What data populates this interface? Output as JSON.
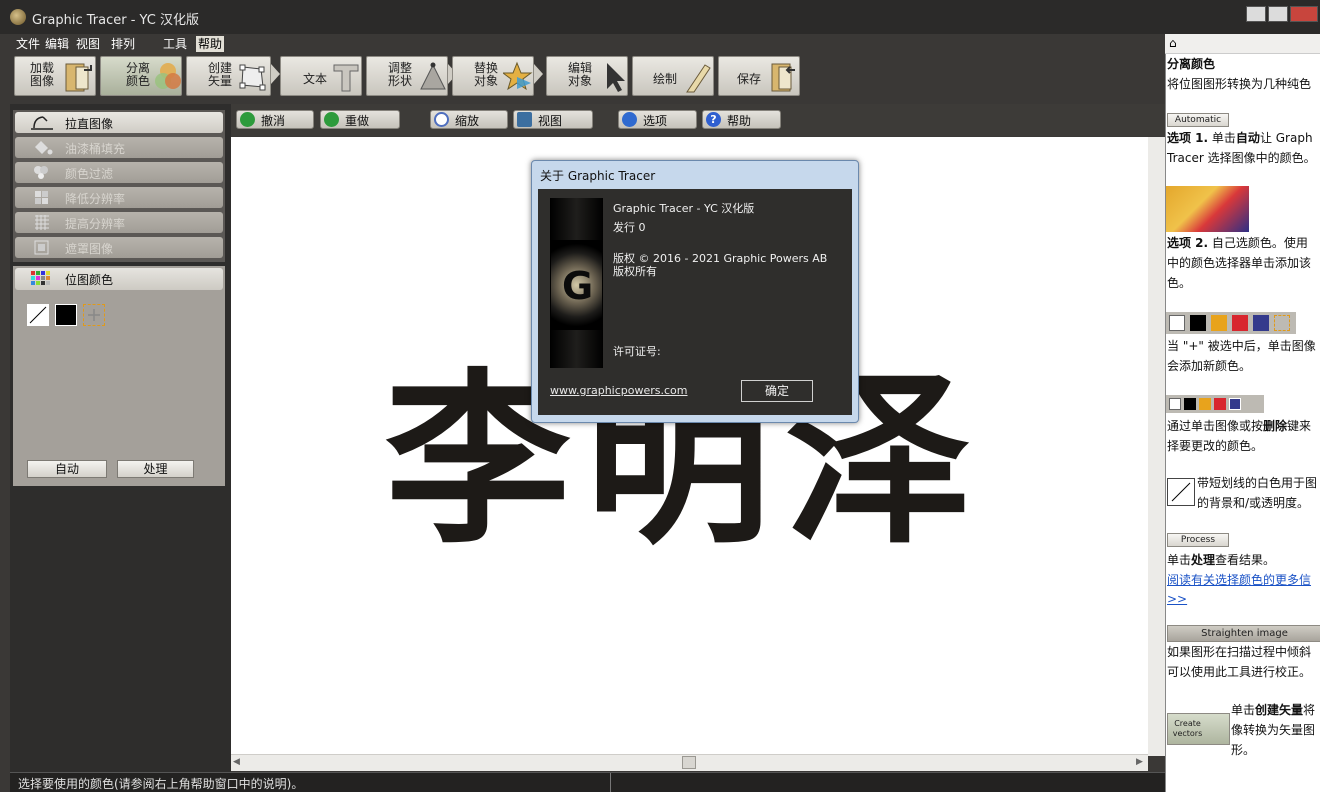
{
  "window": {
    "title": "Graphic Tracer - YC 汉化版"
  },
  "menu": [
    "文件",
    "编辑",
    "视图",
    "排列",
    "工具",
    "帮助"
  ],
  "toolbar": [
    {
      "line1": "加载",
      "line2": "图像",
      "icon": "folder-door-icon"
    },
    {
      "line1": "分离",
      "line2": "颜色",
      "icon": "color-split-icon"
    },
    {
      "line1": "创建",
      "line2": "矢量",
      "icon": "vector-shape-icon"
    },
    {
      "line1": "文本",
      "line2": "",
      "icon": "text-t-icon"
    },
    {
      "line1": "调整",
      "line2": "形状",
      "icon": "shape-adjust-icon"
    },
    {
      "line1": "替换",
      "line2": "对象",
      "icon": "replace-object-icon"
    },
    {
      "line1": "编辑",
      "line2": "对象",
      "icon": "cursor-arrow-icon"
    },
    {
      "line1": "绘制",
      "line2": "",
      "icon": "pencil-icon"
    },
    {
      "line1": "保存",
      "line2": "",
      "icon": "save-door-icon"
    }
  ],
  "left_tools": [
    {
      "label": "拉直图像",
      "enabled": true,
      "icon": "straighten-icon"
    },
    {
      "label": "油漆桶填充",
      "enabled": false,
      "icon": "paint-bucket-icon"
    },
    {
      "label": "颜色过滤",
      "enabled": false,
      "icon": "color-filter-icon"
    },
    {
      "label": "降低分辨率",
      "enabled": false,
      "icon": "reduce-resolution-icon"
    },
    {
      "label": "提高分辨率",
      "enabled": false,
      "icon": "increase-resolution-icon"
    },
    {
      "label": "遮罩图像",
      "enabled": false,
      "icon": "mask-icon"
    }
  ],
  "bitmap_colors": {
    "title": "位图颜色",
    "swatches": [
      "#ffffff",
      "#000000"
    ],
    "auto_label": "自动",
    "process_label": "处理"
  },
  "subtoolbar": [
    {
      "label": "撤消",
      "icon": "undo-icon",
      "color": "#2d9b3c"
    },
    {
      "label": "重做",
      "icon": "redo-icon",
      "color": "#2d9b3c"
    },
    {
      "label": "缩放",
      "icon": "zoom-icon",
      "color": "#4f6fbf"
    },
    {
      "label": "视图",
      "icon": "view-icon",
      "color": "#3c6fa0"
    },
    {
      "label": "选项",
      "icon": "options-gear-icon",
      "color": "#2f6ad0"
    },
    {
      "label": "帮助",
      "icon": "help-icon",
      "color": "#2f5fd0"
    }
  ],
  "canvas": {
    "text": "李明泽"
  },
  "about_dialog": {
    "title": "关于 Graphic Tracer",
    "product": "Graphic Tracer - YC 汉化版",
    "release": "发行 0",
    "copyright": "版权 © 2016 - 2021 Graphic Powers AB",
    "rights": "版权所有",
    "license": "许可证号:",
    "link": "www.graphicpowers.com",
    "ok": "确定",
    "logo_letter": "G"
  },
  "status": {
    "text": "选择要使用的颜色(请参阅右上角帮助窗口中的说明)。"
  },
  "help": {
    "heading": "分离颜色",
    "intro": "将位图图形转换为几种纯色",
    "automatic_btn": "Automatic",
    "opt1_a": "选项 1.",
    "opt1_b": " 单击",
    "opt1_c": "自动",
    "opt1_d": "让 Graph",
    "opt1_e": "Tracer 选择图像中的颜色。",
    "opt2_a": "选项 2.",
    "opt2_b": " 自己选颜色。使用",
    "opt2_c": "中的颜色选择器单击添加该",
    "opt2_d": "色。",
    "plus_a": "当 \"+\" 被选中后，单击图像",
    "plus_b": "会添加新颜色。",
    "del_a": "通过单击图像或按",
    "del_b": "删除",
    "del_c": "键来",
    "del_d": "择要更改的颜色。",
    "white_a": "带短划线的白色用于图",
    "white_b": "的背景和/或透明度。",
    "process_btn": "Process",
    "process_a": "单击",
    "process_b": "处理",
    "process_c": "查看结果。",
    "link_a": "阅读有关选择颜色的更多信",
    "link_b": ">>",
    "straighten_btn": "Straighten image",
    "straighten_a": "如果图形在扫描过程中倾斜",
    "straighten_b": "可以使用此工具进行校正。",
    "create_btn": "Create vectors",
    "create_a": "单击",
    "create_b": "创建矢量",
    "create_c": "将",
    "create_d": "像转换为矢量图",
    "create_e": "形。",
    "palette": [
      "#ffffff",
      "#000000",
      "#e8a31c",
      "#d8262e",
      "#343a8c"
    ]
  }
}
